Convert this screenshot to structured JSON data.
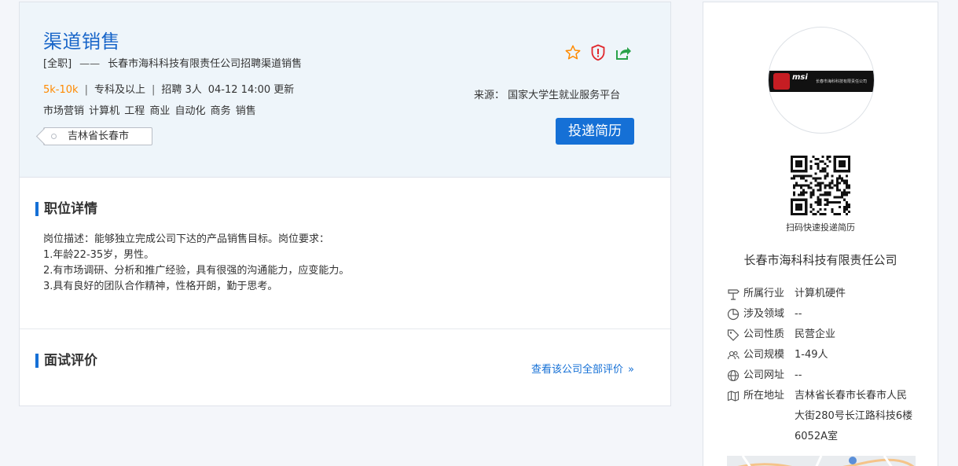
{
  "job": {
    "title": "渠道销售",
    "type": "[全职]",
    "dash": "——",
    "company_headline": "长春市海科科技有限责任公司招聘渠道销售",
    "salary": "5k-10k",
    "sep": "|",
    "education": "专科及以上",
    "recruit": "招聘 3人",
    "updated": "04-12 14:00 更新",
    "tags": "市场营销 计算机 工程 商业 自动化 商务 销售",
    "location": "吉林省长春市",
    "source": "来源： 国家大学生就业服务平台",
    "apply_label": "投递简历"
  },
  "icons": {
    "favorite": "star-icon",
    "report": "shield-alert-icon",
    "share": "share-icon"
  },
  "details": {
    "heading": "职位详情",
    "lines": [
      "岗位描述：能够独立完成公司下达的产品销售目标。岗位要求：",
      "1.年龄22-35岁，男性。",
      "2.有市场调研、分析和推广经验，具有很强的沟通能力，应变能力。",
      "3.具有良好的团队合作精神，性格开朗，勤于思考。"
    ]
  },
  "review": {
    "heading": "面试评价",
    "more_label": "查看该公司全部评价",
    "chevron": "»"
  },
  "sidebar": {
    "logo_text": "msi",
    "logo_caption": "长春市海科科技有限责任公司",
    "qr_caption": "扫码快速投递简历",
    "company_name": "长春市海科科技有限责任公司",
    "info": [
      {
        "icon": "industry-icon",
        "label": "所属行业",
        "value": "计算机硬件"
      },
      {
        "icon": "pie-icon",
        "label": "涉及领域",
        "value": "--"
      },
      {
        "icon": "tag-icon",
        "label": "公司性质",
        "value": "民营企业"
      },
      {
        "icon": "people-icon",
        "label": "公司规模",
        "value": "1-49人"
      },
      {
        "icon": "globe-icon",
        "label": "公司网址",
        "value": "--"
      },
      {
        "icon": "map-icon",
        "label": "所在地址",
        "value": "吉林省长春市长春市人民大街280号长江路科技6楼6052A室"
      }
    ]
  },
  "colors": {
    "accent": "#1570d6",
    "title": "#1966c9",
    "salary": "#ff8a00",
    "header_bg": "#eef5fa",
    "star": "#ff8a00",
    "shield": "#e0262b",
    "share": "#2aa24a"
  }
}
